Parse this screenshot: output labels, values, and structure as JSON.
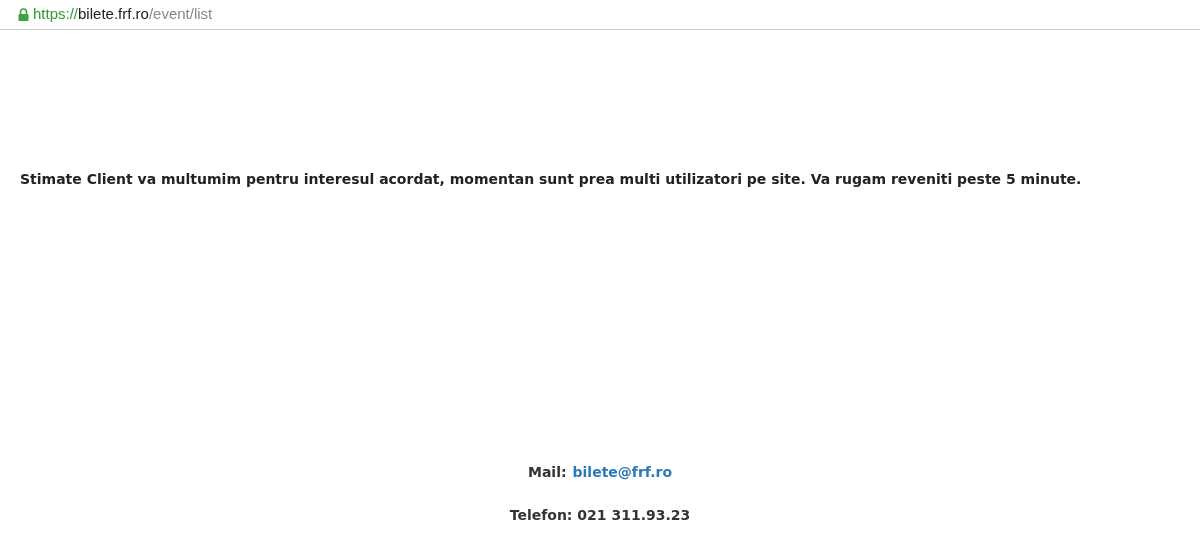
{
  "address_bar": {
    "secure": true,
    "scheme": "https://",
    "host": "bilete.frf.ro",
    "path": "/event/list"
  },
  "message": "Stimate Client va multumim pentru interesul acordat, momentan sunt prea multi utilizatori pe site. Va rugam reveniti peste 5 minute.",
  "contact": {
    "mail_label": "Mail:",
    "mail": "bilete@frf.ro",
    "phone": "Telefon: 021 311.93.23"
  }
}
